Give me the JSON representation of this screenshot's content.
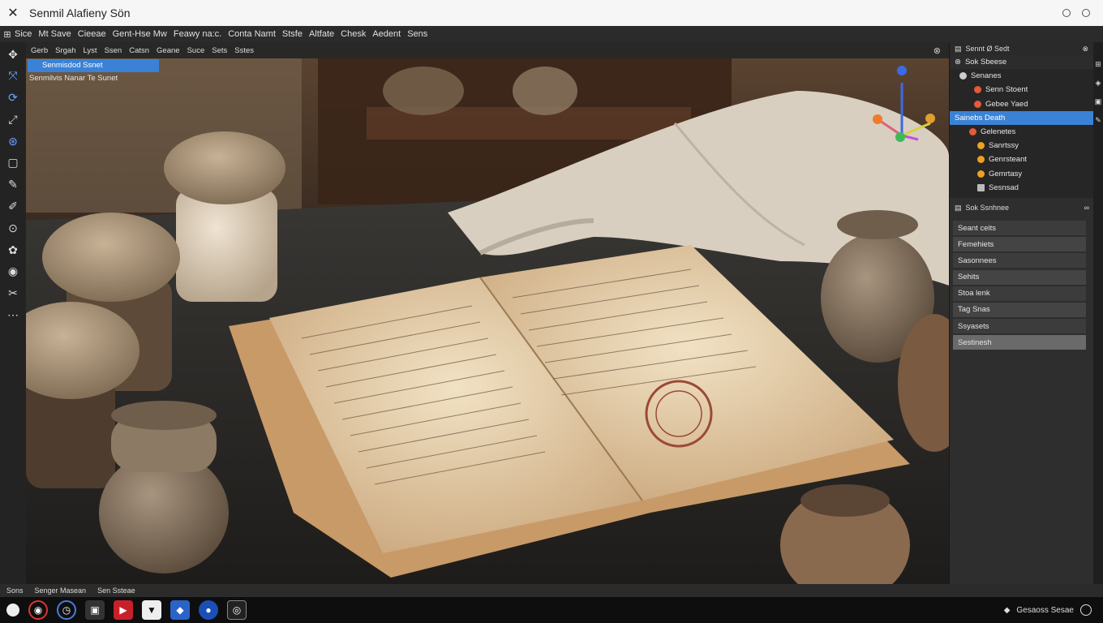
{
  "window": {
    "title": "Senmil Alafieny Sön"
  },
  "menubar": {
    "items": [
      "Sice",
      "Mt Save",
      "Cieeae",
      "Gent-Hse Mw",
      "Feawy na:c.",
      "Conta Namt",
      "Stsfe",
      "Altfate",
      "Chesk",
      "Aedent",
      "Sens"
    ]
  },
  "viewport": {
    "toolbar": [
      "Gerb",
      "Srgah",
      "Lyst",
      "Ssen",
      "Catsn",
      "Geane",
      "Suce",
      "Sets",
      "Sstes"
    ],
    "selected_field": "Senmisdod Ssnet",
    "subline": "Senmilvis Nanar Te Sunet"
  },
  "outliner": {
    "header": "Sennt Ø Sedt",
    "subheader": "Sok Sbeese",
    "items": [
      {
        "label": "Senanes",
        "color": "#cccccc"
      },
      {
        "label": "Senn Stoent",
        "color": "#e45a3a"
      },
      {
        "label": "Gebee Yaed",
        "color": "#e45a3a"
      },
      {
        "label": "Sainebs Death",
        "color": "#3b82d6",
        "selected": true
      },
      {
        "label": "Gelenetes",
        "color": "#e45a3a"
      },
      {
        "label": "Sanrtssy",
        "color": "#f0a020"
      },
      {
        "label": "Genrsteant",
        "color": "#f0a020"
      },
      {
        "label": "Gemrtasy",
        "color": "#f0a020"
      },
      {
        "label": "Sesnsad",
        "color": "#bbbbbb"
      }
    ]
  },
  "properties": {
    "header": "Sok Ssnhnee",
    "rows": [
      {
        "label": "Seant ceits"
      },
      {
        "label": "Femehiets"
      },
      {
        "label": "Sasonnees"
      },
      {
        "label": "Sehits"
      },
      {
        "label": "Stoa lenk"
      },
      {
        "label": "Tag Snas"
      },
      {
        "label": "Ssyasets"
      },
      {
        "label": "Sestinesh",
        "active": true
      }
    ]
  },
  "statusbar": {
    "items": [
      "Sons",
      "Senger Masean",
      "Sen Ssteae"
    ]
  },
  "taskbar": {
    "tray_text": "Gesaoss Sesae"
  },
  "colors": {
    "accent": "#3b82d6"
  }
}
